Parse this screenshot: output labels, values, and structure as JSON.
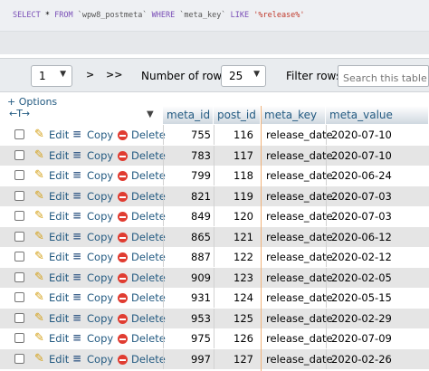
{
  "query": {
    "select": "SELECT",
    "star": "*",
    "from": "FROM",
    "table": "`wpw8_postmeta`",
    "where": "WHERE",
    "column": "`meta_key`",
    "like": "LIKE",
    "pattern": "'%release%'"
  },
  "navigation": {
    "page": "1",
    "next": ">",
    "last": ">>",
    "rows_label": "Number of rows:",
    "rows_value": "25",
    "filter_label": "Filter rows:",
    "filter_placeholder": "Search this table"
  },
  "options_label": "+ Options",
  "column_move": "←T→",
  "sort_indicator": "▼",
  "columns": [
    "meta_id",
    "post_id",
    "meta_key",
    "meta_value"
  ],
  "actions": {
    "edit": "Edit",
    "copy": "Copy",
    "delete": "Delete"
  },
  "rows": [
    {
      "meta_id": "755",
      "post_id": "116",
      "meta_key": "release_date",
      "meta_value": "2020-07-10"
    },
    {
      "meta_id": "783",
      "post_id": "117",
      "meta_key": "release_date",
      "meta_value": "2020-07-10"
    },
    {
      "meta_id": "799",
      "post_id": "118",
      "meta_key": "release_date",
      "meta_value": "2020-06-24"
    },
    {
      "meta_id": "821",
      "post_id": "119",
      "meta_key": "release_date",
      "meta_value": "2020-07-03"
    },
    {
      "meta_id": "849",
      "post_id": "120",
      "meta_key": "release_date",
      "meta_value": "2020-07-03"
    },
    {
      "meta_id": "865",
      "post_id": "121",
      "meta_key": "release_date",
      "meta_value": "2020-06-12"
    },
    {
      "meta_id": "887",
      "post_id": "122",
      "meta_key": "release_date",
      "meta_value": "2020-02-12"
    },
    {
      "meta_id": "909",
      "post_id": "123",
      "meta_key": "release_date",
      "meta_value": "2020-02-05"
    },
    {
      "meta_id": "931",
      "post_id": "124",
      "meta_key": "release_date",
      "meta_value": "2020-05-15"
    },
    {
      "meta_id": "953",
      "post_id": "125",
      "meta_key": "release_date",
      "meta_value": "2020-02-29"
    },
    {
      "meta_id": "975",
      "post_id": "126",
      "meta_key": "release_date",
      "meta_value": "2020-07-09"
    },
    {
      "meta_id": "997",
      "post_id": "127",
      "meta_key": "release_date",
      "meta_value": "2020-02-26"
    }
  ],
  "icons": {
    "edit": "pencil-icon",
    "copy": "copy-icon",
    "delete": "delete-icon"
  },
  "colors": {
    "link": "#235a81",
    "row_alt": "#e5e5e5",
    "delete": "#e03c31"
  }
}
